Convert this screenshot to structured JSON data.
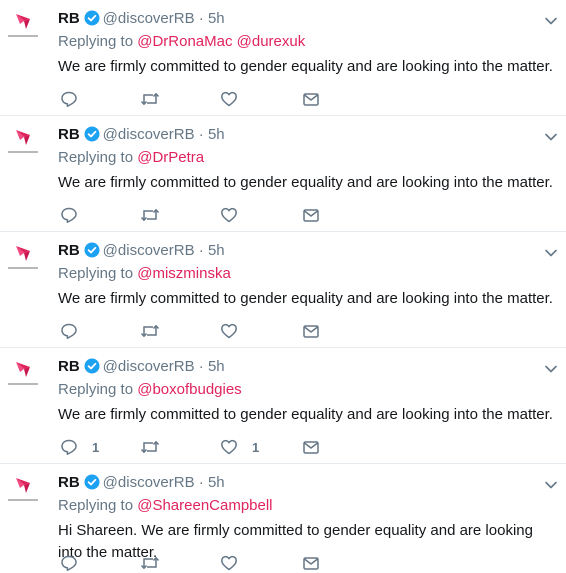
{
  "tweets": [
    {
      "name": "RB",
      "handle": "@discoverRB",
      "dot": " · ",
      "time": "5h",
      "replying_prefix": "Replying to ",
      "mentions_text": "@DrRonaMac @durexuk",
      "text": "We are firmly committed to gender equality and are looking into the matter.",
      "reply_count": "",
      "like_count": ""
    },
    {
      "name": "RB",
      "handle": "@discoverRB",
      "dot": " · ",
      "time": "5h",
      "replying_prefix": "Replying to ",
      "mentions_text": "@DrPetra",
      "text": "We are firmly committed to gender equality and are looking into the matter.",
      "reply_count": "",
      "like_count": ""
    },
    {
      "name": "RB",
      "handle": "@discoverRB",
      "dot": " · ",
      "time": "5h",
      "replying_prefix": "Replying to ",
      "mentions_text": "@miszminska",
      "text": "We are firmly committed to gender equality and are looking into the matter.",
      "reply_count": "",
      "like_count": ""
    },
    {
      "name": "RB",
      "handle": "@discoverRB",
      "dot": " · ",
      "time": "5h",
      "replying_prefix": "Replying to ",
      "mentions_text": "@boxofbudgies",
      "text": "We are firmly committed to gender equality and are looking into the matter.",
      "reply_count": "1",
      "like_count": "1"
    },
    {
      "name": "RB",
      "handle": "@discoverRB",
      "dot": " · ",
      "time": "5h",
      "replying_prefix": "Replying to ",
      "mentions_text": "@ShareenCampbell",
      "text": "Hi Shareen. We are firmly committed to gender equality and are looking into the matter.",
      "reply_count": "",
      "like_count": ""
    }
  ],
  "icons": {
    "reply": "reply-icon",
    "retweet": "retweet-icon",
    "like": "heart-icon",
    "dm": "envelope-icon",
    "verified": "verified-badge-icon",
    "caret": "chevron-down-icon",
    "avatar": "rb-logo"
  },
  "colors": {
    "brand": "#e0245e",
    "verified": "#1da1f2",
    "secondary": "#657786",
    "text": "#14171a"
  }
}
